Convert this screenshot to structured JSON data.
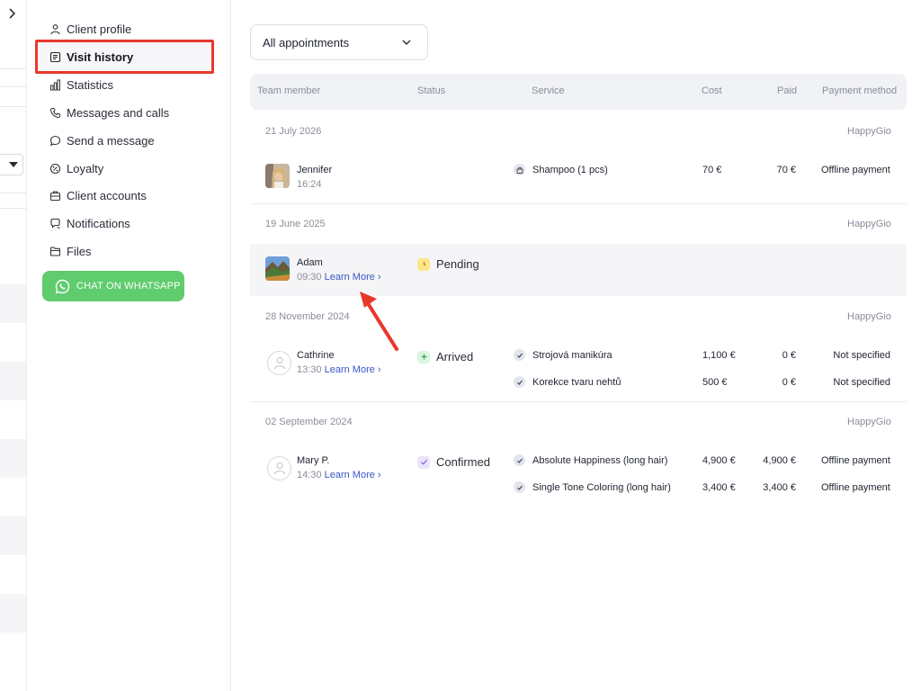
{
  "sidebar": {
    "items": [
      {
        "label": "Client profile",
        "icon": "person-icon"
      },
      {
        "label": "Visit history",
        "icon": "receipt-icon",
        "active": true
      },
      {
        "label": "Statistics",
        "icon": "bar-chart-icon"
      },
      {
        "label": "Messages and calls",
        "icon": "phone-icon"
      },
      {
        "label": "Send a message",
        "icon": "chat-bubble-icon"
      },
      {
        "label": "Loyalty",
        "icon": "percent-badge-icon"
      },
      {
        "label": "Client accounts",
        "icon": "briefcase-icon"
      },
      {
        "label": "Notifications",
        "icon": "notification-icon"
      },
      {
        "label": "Files",
        "icon": "folder-icon"
      }
    ],
    "whatsapp_label": "CHAT ON WHATSAPP"
  },
  "filter": {
    "selected": "All appointments"
  },
  "table": {
    "headers": {
      "team_member": "Team member",
      "status": "Status",
      "service": "Service",
      "cost": "Cost",
      "paid": "Paid",
      "payment_method": "Payment method"
    }
  },
  "groups": [
    {
      "date": "21 July 2026",
      "brand": "HappyGio",
      "member": "Jennifer",
      "time": "16:24",
      "learn_more": "",
      "status": "",
      "services": [
        {
          "name": "Shampoo (1 pcs)",
          "icon": "bag-icon",
          "cost": "70 €",
          "paid": "70 €",
          "method": "Offline payment"
        }
      ]
    },
    {
      "date": "19 June 2025",
      "brand": "HappyGio",
      "member": "Adam",
      "time": "09:30",
      "learn_more": "Learn More",
      "status": "Pending",
      "services": []
    },
    {
      "date": "28 November 2024",
      "brand": "HappyGio",
      "member": "Cathrine",
      "time": "13:30",
      "learn_more": "Learn More",
      "status": "Arrived",
      "services": [
        {
          "name": "Strojová manikúra",
          "icon": "check-icon",
          "cost": "1,100 €",
          "paid": "0 €",
          "method": "Not specified"
        },
        {
          "name": "Korekce tvaru nehtů",
          "icon": "check-icon",
          "cost": "500 €",
          "paid": "0 €",
          "method": "Not specified"
        }
      ]
    },
    {
      "date": "02 September 2024",
      "brand": "HappyGio",
      "member": "Mary P.",
      "time": "14:30",
      "learn_more": "Learn More",
      "status": "Confirmed",
      "services": [
        {
          "name": "Absolute Happiness (long hair)",
          "icon": "check-icon",
          "cost": "4,900 €",
          "paid": "4,900 €",
          "method": "Offline payment"
        },
        {
          "name": "Single Tone Coloring (long hair)",
          "icon": "check-icon",
          "cost": "3,400 €",
          "paid": "3,400 €",
          "method": "Offline payment"
        }
      ]
    }
  ],
  "colors": {
    "highlight_red": "#e8382c",
    "whatsapp_green": "#5fcc6e",
    "link_blue": "#3a55c8",
    "pending_yellow": "#fde68a",
    "arrived_green": "#dcf5e2",
    "confirmed_purple": "#ece4fb"
  }
}
